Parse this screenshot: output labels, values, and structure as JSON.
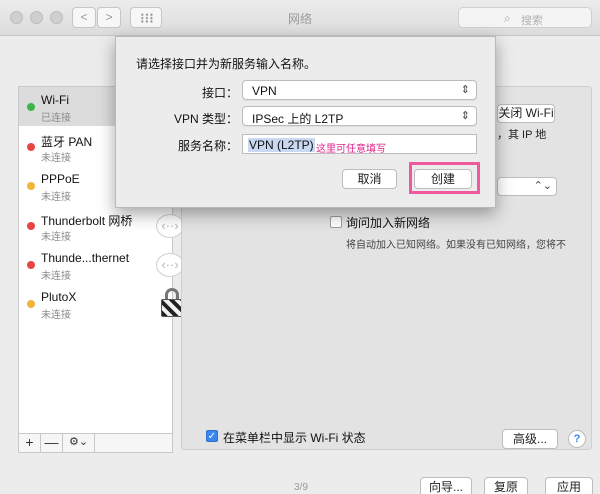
{
  "window": {
    "title": "网络",
    "search_placeholder": "搜索",
    "nav": {
      "back": "<",
      "forward": ">"
    }
  },
  "sidebar": {
    "items": [
      {
        "name": "Wi-Fi",
        "status": "已连接",
        "status_color": "#3cb64a",
        "selected": true
      },
      {
        "name": "蓝牙 PAN",
        "status": "未连接",
        "status_color": "#e64545",
        "selected": false
      },
      {
        "name": "PPPoE",
        "status": "未连接",
        "status_color": "#f0b63b",
        "selected": false
      },
      {
        "name": "Thunderbolt 网桥",
        "status": "未连接",
        "status_color": "#e64545",
        "selected": false
      },
      {
        "name": "Thunde...thernet",
        "status": "未连接",
        "status_color": "#e64545",
        "selected": false
      },
      {
        "name": "PlutoX",
        "status": "未连接",
        "status_color": "#f0b63b",
        "selected": false
      }
    ],
    "toolbar": {
      "add": "+",
      "remove": "—",
      "gear": "⚙︎⌄"
    }
  },
  "pane": {
    "wifi_button": "关闭 Wi-Fi",
    "ip_text": "，其 IP 地",
    "ask_join_label": "询问加入新网络",
    "ask_join_desc": "将自动加入已知网络。如果没有已知网络，您将不",
    "show_in_menu_label": "在菜单栏中显示 Wi-Fi 状态",
    "advanced_button": "高级...",
    "help": "?"
  },
  "bottom": {
    "page_indicator": "3/9",
    "assist_button": "向导...",
    "revert_button": "复原",
    "apply_button": "应用"
  },
  "dialog": {
    "prompt": "请选择接口并为新服务输入名称。",
    "interface_label": "接口：",
    "interface_value": "VPN",
    "vpn_type_label": "VPN 类型：",
    "vpn_type_value": "IPSec 上的 L2TP",
    "service_name_label": "服务名称：",
    "service_name_value": "VPN (L2TP)",
    "service_name_hint": "这里可任意填写",
    "cancel_button": "取消",
    "create_button": "创建",
    "highlight_color": "#ef5a9d"
  }
}
